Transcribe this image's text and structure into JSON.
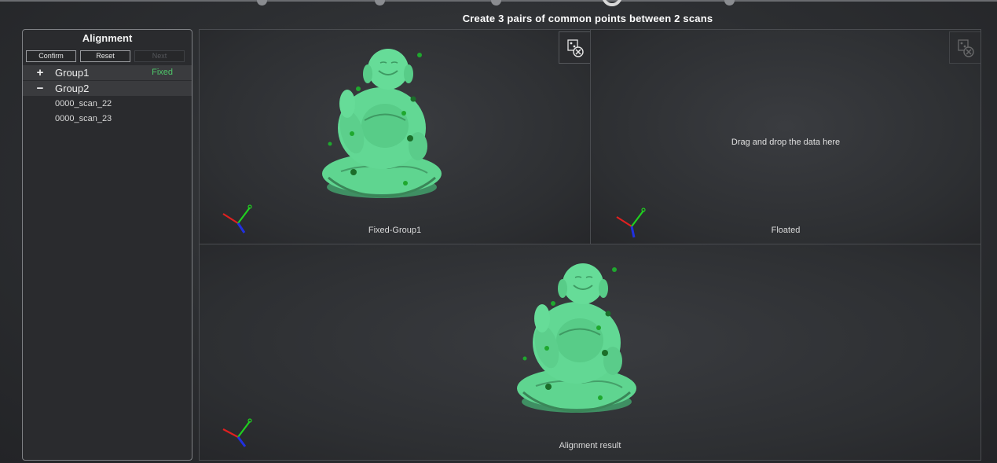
{
  "instruction": "Create 3 pairs of common points between 2 scans",
  "panel": {
    "title": "Alignment",
    "buttons": {
      "confirm": "Confirm",
      "reset": "Reset",
      "next": "Next"
    },
    "groups": [
      {
        "sign": "+",
        "name": "Group1",
        "tag": "Fixed"
      },
      {
        "sign": "−",
        "name": "Group2",
        "tag": ""
      }
    ],
    "scans": [
      "0000_scan_22",
      "0000_scan_23"
    ]
  },
  "viewports": {
    "fixed": {
      "label": "Fixed-Group1",
      "icon": "clear-points-icon"
    },
    "floated": {
      "label": "Floated",
      "hint": "Drag and drop the data here",
      "icon": "clear-points-icon"
    },
    "result": {
      "label": "Alignment result"
    }
  },
  "colors": {
    "model": "#5fd590",
    "point": "#1fa82e",
    "accent": "#4fc86a"
  }
}
